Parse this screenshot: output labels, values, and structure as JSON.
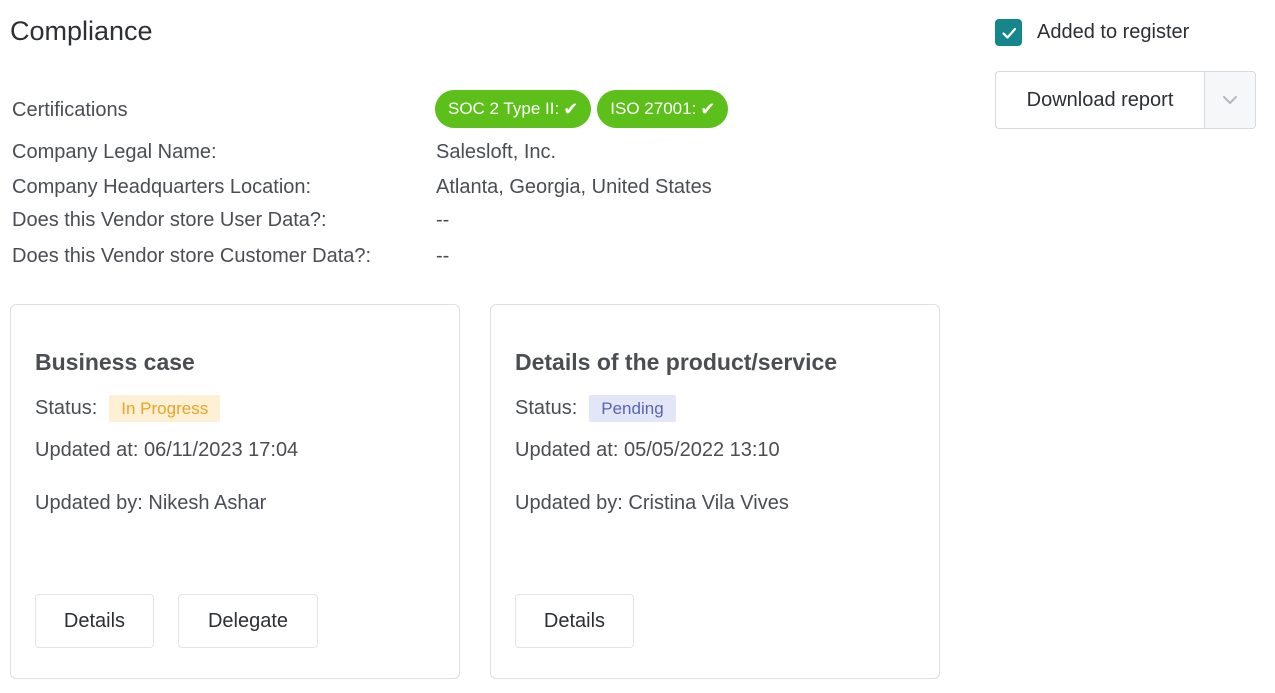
{
  "page": {
    "title": "Compliance"
  },
  "register": {
    "checked": true,
    "label": "Added to register"
  },
  "download": {
    "label": "Download report",
    "caret_icon": "chevron-down-icon"
  },
  "info": {
    "certifications_label": "Certifications",
    "certifications": [
      {
        "label": "SOC 2 Type II:",
        "check": "✔"
      },
      {
        "label": "ISO 27001:",
        "check": "✔"
      }
    ],
    "legal_name_label": "Company Legal Name:",
    "legal_name_value": "Salesloft, Inc.",
    "hq_label": "Company Headquarters Location:",
    "hq_value": "Atlanta, Georgia, United States",
    "user_data_label": "Does this Vendor store User Data?:",
    "user_data_value": "--",
    "customer_data_label": "Does this Vendor store Customer Data?:",
    "customer_data_value": "--"
  },
  "cards": [
    {
      "title": "Business case",
      "status_label": "Status:",
      "status": "In Progress",
      "status_color": "#e8a424",
      "updated_at": "Updated at: 06/11/2023 17:04",
      "updated_by": "Updated by: Nikesh Ashar",
      "actions": [
        "Details",
        "Delegate"
      ]
    },
    {
      "title": "Details of the product/service",
      "status_label": "Status:",
      "status": "Pending",
      "status_color": "#5a64b4",
      "updated_at": "Updated at: 05/05/2022 13:10",
      "updated_by": "Updated by: Cristina Vila Vives",
      "actions": [
        "Details"
      ]
    }
  ],
  "colors": {
    "accent": "#15868c",
    "cert_badge": "#5cbf1a"
  }
}
